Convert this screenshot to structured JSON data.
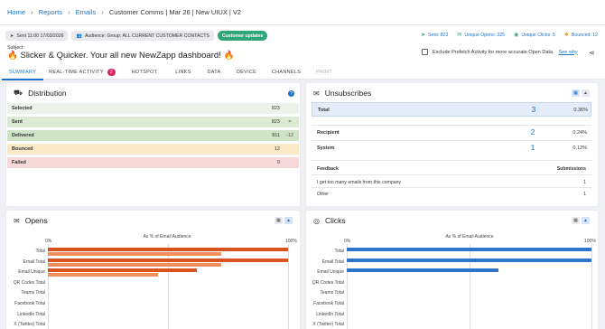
{
  "breadcrumb": {
    "items": [
      {
        "label": "Home",
        "link": true
      },
      {
        "label": "Reports",
        "link": true
      },
      {
        "label": "Emails",
        "link": true
      },
      {
        "label": "Customer Comms | Mar 26 | New UIUX | V2",
        "link": false
      }
    ]
  },
  "header": {
    "sent_pill": "Sent 11:00 17/03/2026",
    "audience_pill": "Audience: Group: ALL CURRENT CUSTOMER CONTACTS",
    "tag_pill": "Customer updates",
    "stats": {
      "sent": "Sent: 823",
      "opens": "Unique Opens: 325",
      "clicks": "Unique Clicks: 5",
      "bounced": "Bounced: 12"
    },
    "subject_label": "Subject:",
    "subject": "Slicker & Quicker. Your all new NewZapp dashboard!",
    "prefetch_text": "Exclude Prefetch Activity for more accurate Open Data.",
    "prefetch_link": "See why"
  },
  "tabs": [
    {
      "label": "SUMMARY",
      "active": true
    },
    {
      "label": "REAL-TIME ACTIVITY",
      "badge": "2"
    },
    {
      "label": "HOTSPOT"
    },
    {
      "label": "LINKS"
    },
    {
      "label": "DATA"
    },
    {
      "label": "DEVICE"
    },
    {
      "label": "CHANNELS"
    },
    {
      "label": "PRINT",
      "disabled": true
    }
  ],
  "distribution": {
    "title": "Distribution",
    "rows": [
      {
        "label": "Selected",
        "value": "823",
        "delta": "",
        "bg": "#edf3ea"
      },
      {
        "label": "Sent",
        "value": "823",
        "delta": "=",
        "bg": "#dcebd4"
      },
      {
        "label": "Delivered",
        "value": "811",
        "delta": "-12",
        "bg": "#cfe3c6"
      },
      {
        "label": "Bounced",
        "value": "12",
        "delta": "",
        "bg": "#fbe9c7"
      },
      {
        "label": "Failed",
        "value": "0",
        "delta": "",
        "bg": "#f6d8d8"
      }
    ]
  },
  "unsubscribes": {
    "title": "Unsubscribes",
    "total": {
      "label": "Total",
      "count": "3",
      "pct": "0.36%"
    },
    "rows": [
      {
        "label": "Recipient",
        "count": "2",
        "pct": "0.24%"
      },
      {
        "label": "System",
        "count": "1",
        "pct": "0.12%"
      }
    ],
    "feedback_header": "Feedback",
    "submissions_header": "Submissions",
    "feedback": [
      {
        "label": "I get too many emails from this company",
        "value": "1"
      },
      {
        "label": "Other",
        "value": "1"
      }
    ]
  },
  "opens": {
    "title": "Opens",
    "chart_title": "As % of Email Audience",
    "axis_min": "0%",
    "axis_max": "100%"
  },
  "clicks": {
    "title": "Clicks",
    "chart_title": "As % of Email Audience",
    "axis_min": "0%",
    "axis_max": "100%"
  },
  "chart_data": [
    {
      "type": "bar",
      "orientation": "horizontal",
      "title": "As % of Email Audience",
      "xlim": [
        0,
        100
      ],
      "categories": [
        "Total",
        "Email Total",
        "Email Unique",
        "QR Codes Total",
        "Teams Total",
        "Facebook Total",
        "LinkedIn Total",
        "X (Twitter) Total"
      ],
      "series": [
        {
          "values": [
            100,
            100,
            62,
            0,
            0,
            0,
            0,
            0
          ],
          "color": "#d9531e"
        },
        {
          "values": [
            72,
            72,
            46,
            0,
            0,
            0,
            0,
            0
          ],
          "color": "#f08f5b"
        }
      ]
    },
    {
      "type": "bar",
      "orientation": "horizontal",
      "title": "As % of Email Audience",
      "xlim": [
        0,
        100
      ],
      "categories": [
        "Total",
        "Email Total",
        "Email Unique",
        "QR Codes Total",
        "Teams Total",
        "Facebook Total",
        "LinkedIn Total",
        "X (Twitter) Total"
      ],
      "series": [
        {
          "values": [
            100,
            100,
            62,
            0,
            0,
            0,
            0,
            0
          ],
          "color": "#2e74c9"
        }
      ]
    }
  ]
}
